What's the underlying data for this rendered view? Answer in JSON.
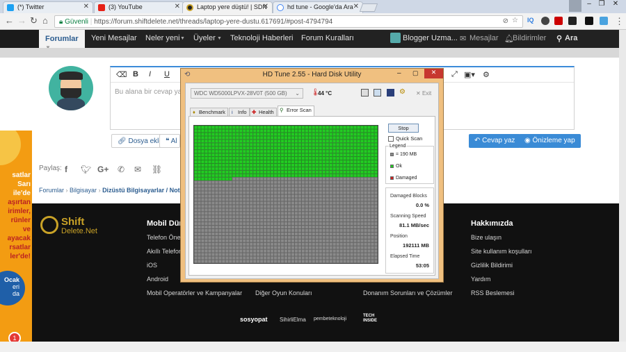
{
  "browser": {
    "tabs": [
      {
        "label": "(*) Twitter",
        "icon": "twitter-icon",
        "color": "#1da1f2"
      },
      {
        "label": "(3) YouTube",
        "icon": "youtube-icon",
        "color": "#e62117"
      },
      {
        "label": "Laptop yere düştü! | SDN",
        "icon": "shiftdelete-icon",
        "color": "#c9a227"
      },
      {
        "label": "hd tune - Google'da Ara",
        "icon": "google-icon",
        "color": "#4285f4"
      }
    ],
    "secure_label": "Güvenli",
    "url": "https://forum.shiftdelete.net/threads/laptop-yere-dustu.617691/#post-4794794"
  },
  "site_nav": {
    "active": "Forumlar",
    "items": [
      "Yeni Mesajlar",
      "Neler yeni",
      "Üyeler",
      "Teknoloji Haberleri",
      "Forum Kuralları"
    ],
    "user": "Blogger Uzma...",
    "messages": "Mesajlar",
    "alerts": "Bildirimler",
    "search": "Ara"
  },
  "editor": {
    "placeholder": "Bu alana bir cevap ya",
    "attach": "Dosya ekle",
    "quote_partial": "Al",
    "reply": "Cevap yaz",
    "preview": "Önizleme yap"
  },
  "share_label": "Paylaş:",
  "breadcrumbs": [
    "Forumlar",
    "Bilgisayar",
    "Dizüstü Bilgisayarlar / Not"
  ],
  "ad": {
    "lines": [
      "satlar",
      "Sarı",
      "ile'de",
      "aşırtan",
      "irimler,",
      "rünler",
      "ve",
      "ayacak",
      "rsatlar",
      "ler'de!"
    ],
    "badge": [
      "Ocak",
      "eri",
      "da"
    ],
    "bubble": "1"
  },
  "footer": {
    "logo_line1": "Shift",
    "logo_line2": "Delete.Net",
    "col1_title": "Mobil Dün",
    "col1": [
      "Telefon Öner",
      "Akıllı Telefon",
      "iOS",
      "Android",
      "Mobil Operatörler ve Kampanyalar"
    ],
    "col2_item": "Diğer Oyun Konuları",
    "col3_item": "Donanım Sorunları ve Çözümler",
    "col4_title": "Hakkımızda",
    "col4": [
      "Bize ulaşın",
      "Site kullanım koşulları",
      "Gizlilik Bildirimi",
      "Yardım",
      "RSS Beslemesi"
    ],
    "partners": [
      "sosyopat",
      "SihirliElma",
      "pembeteknoloji",
      "TECH INSIDE"
    ]
  },
  "hdtune": {
    "title": "HD Tune 2.55 - Hard Disk Utility",
    "drive": "WDC    WD5000LPVX-28V0T (500 GB)",
    "temperature": "44 °C",
    "exit": "Exit",
    "tabs": [
      "Benchmark",
      "Info",
      "Health",
      "Error Scan"
    ],
    "stop": "Stop",
    "quick_scan": "Quick Scan",
    "legend_title": "Legend",
    "legend": [
      {
        "label": "= 190 MB",
        "color": "#8a8a8a"
      },
      {
        "label": "Ok",
        "color": "#22cc22"
      },
      {
        "label": "Damaged",
        "color": "#cc2222"
      }
    ],
    "damaged_blocks_label": "Damaged Blocks",
    "damaged_blocks": "0.0 %",
    "speed_label": "Scanning Speed",
    "speed": "81.1 MB/sec",
    "position_label": "Position",
    "position": "192111 MB",
    "elapsed_label": "Elapsed Time",
    "elapsed": "53:05",
    "scan_progress": 0.38
  }
}
